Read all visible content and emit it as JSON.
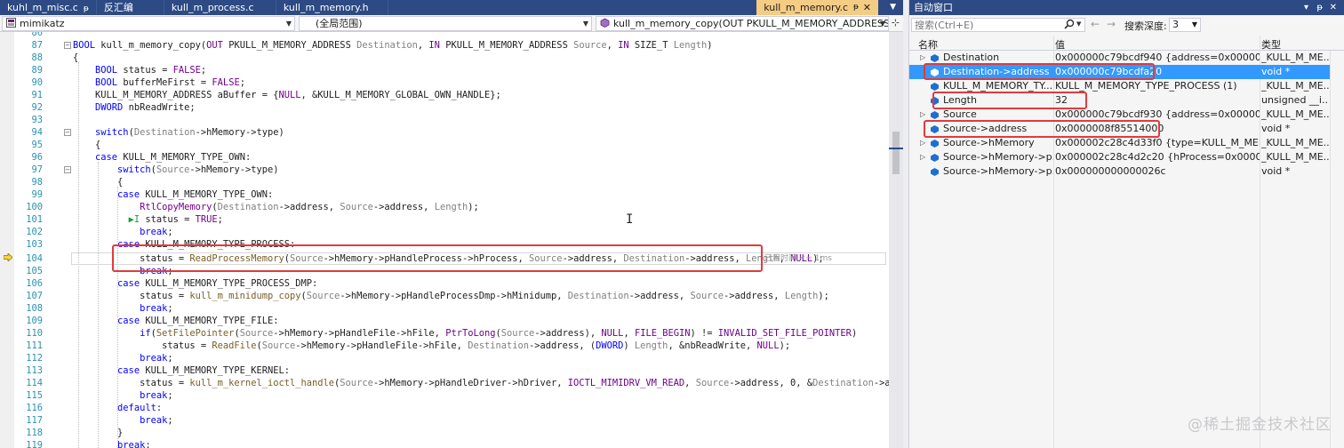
{
  "tabs": [
    {
      "label": "kuhl_m_misc.c",
      "pin": "ᵽ"
    },
    {
      "label": "反汇编"
    },
    {
      "label": "kull_m_process.c"
    },
    {
      "label": "kull_m_memory.h"
    }
  ],
  "active_tab": {
    "label": "kull_m_memory.c",
    "pin": "ᵽ",
    "close": "✕"
  },
  "nav": {
    "project": "mimikatz",
    "scope": "(全局范围)",
    "function": "kull_m_memory_copy(OUT PKULL_M_MEMORY_ADDRESS D"
  },
  "code": {
    "perf_tip": "已用时间 <= 1ms",
    "lines": [
      {
        "num": "86",
        "text": ""
      },
      {
        "num": "87",
        "text": "BOOL kull_m_memory_copy(OUT PKULL_M_MEMORY_ADDRESS Destination, IN PKULL_M_MEMORY_ADDRESS Source, IN SIZE_T Length)"
      },
      {
        "num": "88",
        "text": "{"
      },
      {
        "num": "89",
        "text": "    BOOL status = FALSE;"
      },
      {
        "num": "90",
        "text": "    BOOL bufferMeFirst = FALSE;"
      },
      {
        "num": "91",
        "text": "    KULL_M_MEMORY_ADDRESS aBuffer = {NULL, &KULL_M_MEMORY_GLOBAL_OWN_HANDLE};"
      },
      {
        "num": "92",
        "text": "    DWORD nbReadWrite;"
      },
      {
        "num": "93",
        "text": ""
      },
      {
        "num": "94",
        "text": "    switch(Destination->hMemory->type)"
      },
      {
        "num": "95",
        "text": "    {"
      },
      {
        "num": "96",
        "text": "    case KULL_M_MEMORY_TYPE_OWN:"
      },
      {
        "num": "97",
        "text": "        switch(Source->hMemory->type)"
      },
      {
        "num": "98",
        "text": "        {"
      },
      {
        "num": "99",
        "text": "        case KULL_M_MEMORY_TYPE_OWN:"
      },
      {
        "num": "100",
        "text": "            RtlCopyMemory(Destination->address, Source->address, Length);"
      },
      {
        "num": "101",
        "text": "            status = TRUE;"
      },
      {
        "num": "102",
        "text": "            break;"
      },
      {
        "num": "103",
        "text": "        case KULL_M_MEMORY_TYPE_PROCESS:"
      },
      {
        "num": "104",
        "text": "            status = ReadProcessMemory(Source->hMemory->pHandleProcess->hProcess, Source->address, Destination->address, Length, NULL);"
      },
      {
        "num": "105",
        "text": "            break;"
      },
      {
        "num": "106",
        "text": "        case KULL_M_MEMORY_TYPE_PROCESS_DMP:"
      },
      {
        "num": "107",
        "text": "            status = kull_m_minidump_copy(Source->hMemory->pHandleProcessDmp->hMinidump, Destination->address, Source->address, Length);"
      },
      {
        "num": "108",
        "text": "            break;"
      },
      {
        "num": "109",
        "text": "        case KULL_M_MEMORY_TYPE_FILE:"
      },
      {
        "num": "110",
        "text": "            if(SetFilePointer(Source->hMemory->pHandleFile->hFile, PtrToLong(Source->address), NULL, FILE_BEGIN) != INVALID_SET_FILE_POINTER)"
      },
      {
        "num": "111",
        "text": "                status = ReadFile(Source->hMemory->pHandleFile->hFile, Destination->address, (DWORD) Length, &nbReadWrite, NULL);"
      },
      {
        "num": "112",
        "text": "            break;"
      },
      {
        "num": "113",
        "text": "        case KULL_M_MEMORY_TYPE_KERNEL:"
      },
      {
        "num": "114",
        "text": "            status = kull_m_kernel_ioctl_handle(Source->hMemory->pHandleDriver->hDriver, IOCTL_MIMIDRV_VM_READ, Source->address, 0, &Destination->address, (PDWORD"
      },
      {
        "num": "115",
        "text": "            break;"
      },
      {
        "num": "116",
        "text": "        default:"
      },
      {
        "num": "117",
        "text": "            break;"
      },
      {
        "num": "118",
        "text": "        }"
      },
      {
        "num": "119",
        "text": "        break;"
      }
    ]
  },
  "autos": {
    "title": "自动窗口",
    "pin": "ᵽ",
    "close": "✕",
    "search_placeholder": "搜索(Ctrl+E)",
    "depth_label": "搜索深度:",
    "depth_value": "3",
    "columns": {
      "name": "名称",
      "value": "值",
      "type": "类型"
    },
    "rows": [
      {
        "name": "Destination",
        "value": "0x000000c79bcdf940 {address=0x000000c7...",
        "type": "_KULL_M_ME...",
        "expand": true,
        "selected": false
      },
      {
        "name": "Destination->address",
        "value": "0x000000c79bcdfa20",
        "type": "void *",
        "expand": false,
        "selected": true
      },
      {
        "name": "KULL_M_MEMORY_TY...",
        "value": "KULL_M_MEMORY_TYPE_PROCESS (1)",
        "type": "_KULL_M_ME...",
        "expand": false,
        "selected": false
      },
      {
        "name": "Length",
        "value": "32",
        "type": "unsigned __i...",
        "expand": false,
        "selected": false
      },
      {
        "name": "Source",
        "value": "0x000000c79bcdf930 {address=0x0000008f...",
        "type": "_KULL_M_ME...",
        "expand": true,
        "selected": false
      },
      {
        "name": "Source->address",
        "value": "0x0000008f85514000",
        "type": "void *",
        "expand": false,
        "selected": false
      },
      {
        "name": "Source->hMemory",
        "value": "0x000002c28c4d33f0 {type=KULL_M_MEMO...",
        "type": "_KULL_M_ME...",
        "expand": true,
        "selected": false
      },
      {
        "name": "Source->hMemory->p...",
        "value": "0x000002c28c4d2c20 {hProcess=0x0000000...",
        "type": "_KULL_M_ME...",
        "expand": true,
        "selected": false
      },
      {
        "name": "Source->hMemory->p...",
        "value": "0x000000000000026c",
        "type": "void *",
        "expand": false,
        "selected": false
      }
    ]
  },
  "watermark": "@稀土掘金技术社区",
  "colors": {
    "accent": "#2d4a84",
    "active_tab": "#f5cc84",
    "selection": "#3399ff",
    "annotation": "#e03b3b"
  }
}
